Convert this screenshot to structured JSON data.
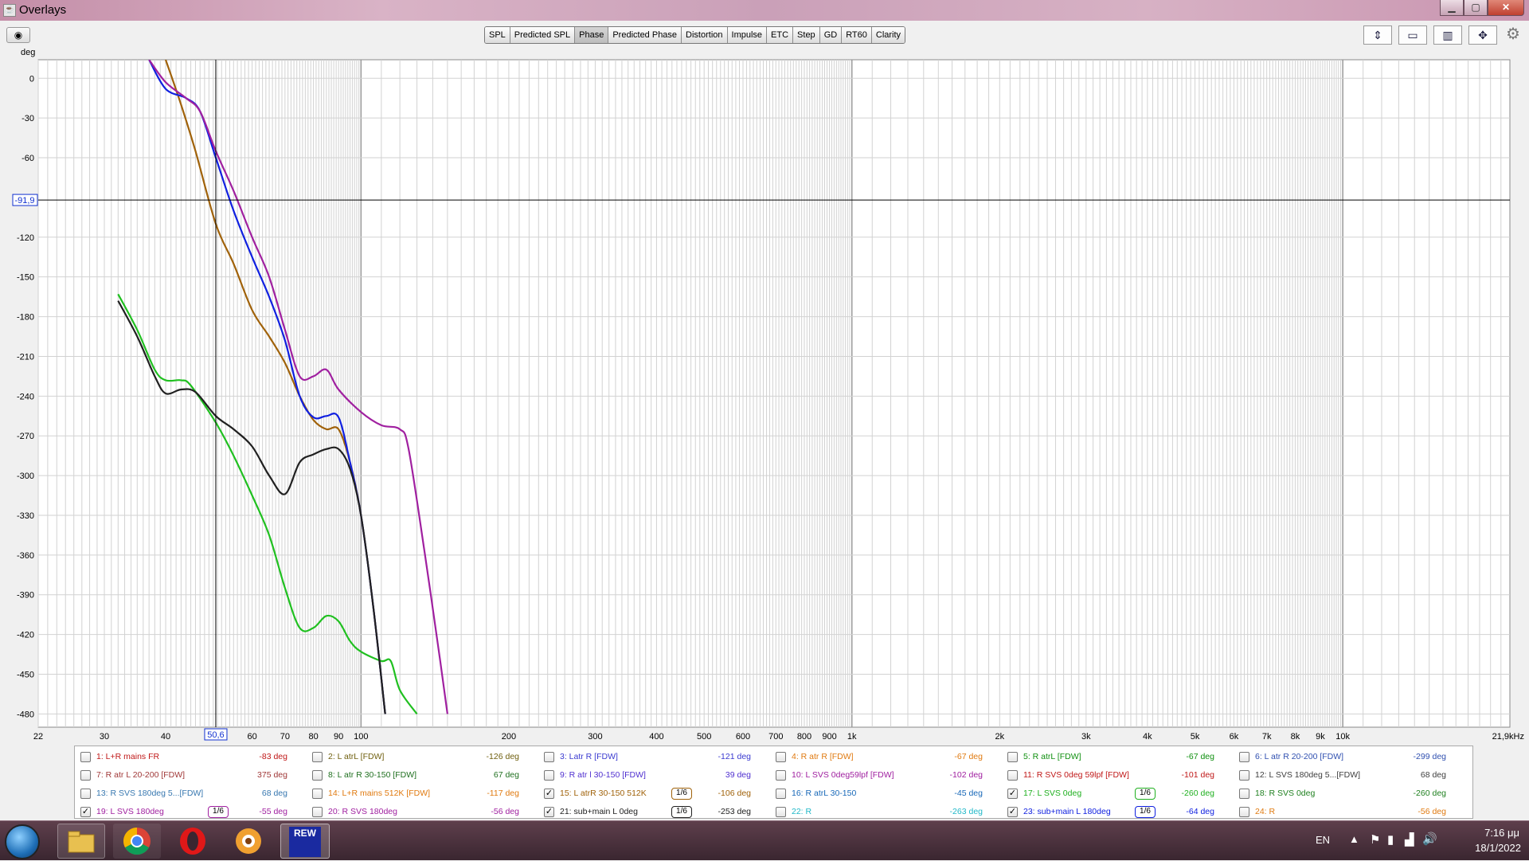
{
  "window": {
    "title": "Overlays",
    "minimize": "▁",
    "maximize": "▢",
    "close": "✕"
  },
  "toolbar": {
    "tabs": [
      "SPL",
      "Predicted SPL",
      "Phase",
      "Predicted Phase",
      "Distortion",
      "Impulse",
      "ETC",
      "Step",
      "GD",
      "RT60",
      "Clarity"
    ],
    "active_tab": "Phase"
  },
  "chart": {
    "y_unit": "deg",
    "y_ticks": [
      "0",
      "-30",
      "-60",
      "-120",
      "-150",
      "-180",
      "-210",
      "-240",
      "-270",
      "-300",
      "-330",
      "-360",
      "-390",
      "-420",
      "-450",
      "-480"
    ],
    "x_ticks": [
      "22",
      "30",
      "40",
      "60",
      "70",
      "80",
      "90",
      "100",
      "200",
      "300",
      "400",
      "500",
      "600",
      "700",
      "800",
      "900",
      "1k",
      "2k",
      "3k",
      "4k",
      "5k",
      "6k",
      "7k",
      "8k",
      "9k",
      "10k",
      "21,9kHz"
    ],
    "cursor_x": "50,6",
    "cursor_y": "-91,9"
  },
  "chart_data": {
    "type": "line",
    "x_scale": "log",
    "x_range_hz": [
      22,
      21900
    ],
    "y_range_deg": [
      -490,
      14
    ],
    "cursor": {
      "x_hz": 50.6,
      "y_deg": -91.9
    },
    "series": [
      {
        "name": "15: L atrR 30-150 512K",
        "color": "#a0620a",
        "points": [
          [
            40,
            14
          ],
          [
            43,
            -20
          ],
          [
            46,
            -55
          ],
          [
            50.6,
            -110
          ],
          [
            55,
            -140
          ],
          [
            60,
            -175
          ],
          [
            65,
            -195
          ],
          [
            70,
            -215
          ],
          [
            75,
            -240
          ],
          [
            80,
            -258
          ],
          [
            85,
            -265
          ],
          [
            90,
            -265
          ],
          [
            95,
            -290
          ],
          [
            100,
            -330
          ],
          [
            106,
            -400
          ],
          [
            112,
            -480
          ]
        ]
      },
      {
        "name": "23: sub+main L 180deg",
        "color": "#1020e0",
        "points": [
          [
            37,
            14
          ],
          [
            40,
            -8
          ],
          [
            44,
            -15
          ],
          [
            47,
            -25
          ],
          [
            50.6,
            -60
          ],
          [
            55,
            -100
          ],
          [
            60,
            -135
          ],
          [
            65,
            -165
          ],
          [
            70,
            -198
          ],
          [
            75,
            -240
          ],
          [
            80,
            -256
          ],
          [
            85,
            -255
          ],
          [
            90,
            -256
          ],
          [
            95,
            -290
          ],
          [
            100,
            -330
          ],
          [
            106,
            -400
          ],
          [
            112,
            -480
          ]
        ]
      },
      {
        "name": "19: L SVS 180deg",
        "color": "#a020a0",
        "points": [
          [
            37,
            14
          ],
          [
            40,
            -3
          ],
          [
            44,
            -15
          ],
          [
            47,
            -25
          ],
          [
            50.6,
            -55
          ],
          [
            55,
            -85
          ],
          [
            60,
            -120
          ],
          [
            65,
            -150
          ],
          [
            70,
            -190
          ],
          [
            75,
            -225
          ],
          [
            80,
            -225
          ],
          [
            85,
            -220
          ],
          [
            90,
            -235
          ],
          [
            100,
            -252
          ],
          [
            110,
            -262
          ],
          [
            120,
            -265
          ],
          [
            125,
            -280
          ],
          [
            135,
            -360
          ],
          [
            145,
            -440
          ],
          [
            150,
            -480
          ]
        ]
      },
      {
        "name": "17: L SVS 0deg",
        "color": "#20c020",
        "points": [
          [
            32,
            -163
          ],
          [
            35,
            -190
          ],
          [
            38,
            -220
          ],
          [
            40,
            -228
          ],
          [
            43,
            -228
          ],
          [
            45,
            -232
          ],
          [
            50.6,
            -260
          ],
          [
            55,
            -285
          ],
          [
            60,
            -315
          ],
          [
            65,
            -345
          ],
          [
            70,
            -385
          ],
          [
            75,
            -415
          ],
          [
            80,
            -415
          ],
          [
            85,
            -406
          ],
          [
            90,
            -410
          ],
          [
            95,
            -425
          ],
          [
            100,
            -433
          ],
          [
            110,
            -440
          ],
          [
            115,
            -440
          ],
          [
            120,
            -462
          ],
          [
            130,
            -480
          ]
        ]
      },
      {
        "name": "21: sub+main L 0deg",
        "color": "#202020",
        "points": [
          [
            32,
            -168
          ],
          [
            35,
            -195
          ],
          [
            38,
            -225
          ],
          [
            40,
            -238
          ],
          [
            43,
            -235
          ],
          [
            46,
            -237
          ],
          [
            50.6,
            -255
          ],
          [
            55,
            -265
          ],
          [
            60,
            -278
          ],
          [
            65,
            -300
          ],
          [
            70,
            -314
          ],
          [
            75,
            -290
          ],
          [
            80,
            -284
          ],
          [
            85,
            -280
          ],
          [
            90,
            -280
          ],
          [
            95,
            -295
          ],
          [
            100,
            -330
          ],
          [
            106,
            -400
          ],
          [
            112,
            -480
          ]
        ]
      }
    ]
  },
  "legend": [
    [
      {
        "n": "1: L+R mains FR",
        "v": "-83 deg",
        "c": "#c01818",
        "k": false
      },
      {
        "n": "2: L atrL [FDW]",
        "v": "-126 deg",
        "c": "#706010",
        "k": false
      },
      {
        "n": "3: Latr R [FDW]",
        "v": "-121 deg",
        "c": "#3a3ad0",
        "k": false
      },
      {
        "n": "4: R atr R [FDW]",
        "v": "-67 deg",
        "c": "#e07a10",
        "k": false
      },
      {
        "n": "5: R atrL [FDW]",
        "v": "-67 deg",
        "c": "#109010",
        "k": false
      },
      {
        "n": "6: L atr R 20-200 [FDW]",
        "v": "-299 deg",
        "c": "#3050b0",
        "k": false
      }
    ],
    [
      {
        "n": "7: R atr L 20-200 [FDW]",
        "v": "375 deg",
        "c": "#a03838",
        "k": false
      },
      {
        "n": "8: L atr R 30-150 [FDW]",
        "v": "67 deg",
        "c": "#207020",
        "k": false
      },
      {
        "n": "9: R atr l 30-150 [FDW]",
        "v": "39 deg",
        "c": "#5030d0",
        "k": false
      },
      {
        "n": "10: L SVS 0deg59lpf [FDW]",
        "v": "-102 deg",
        "c": "#a020a0",
        "k": false
      },
      {
        "n": "11: R SVS 0deg 59lpf [FDW]",
        "v": "-101 deg",
        "c": "#c01818",
        "k": false
      },
      {
        "n": "12: L SVS 180deg 5...[FDW]",
        "v": "68 deg",
        "c": "#404040",
        "k": false
      }
    ],
    [
      {
        "n": "13: R SVS 180deg 5...[FDW]",
        "v": "68 deg",
        "c": "#3878b0",
        "k": false
      },
      {
        "n": "14: L+R mains 512K [FDW]",
        "v": "-117 deg",
        "c": "#e07a10",
        "k": false
      },
      {
        "n": "15: L atrR 30-150 512K",
        "v": "-106 deg",
        "c": "#a0620a",
        "k": true,
        "s": "1/6"
      },
      {
        "n": "16: R atrL 30-150",
        "v": "-45 deg",
        "c": "#1868b8",
        "k": false
      },
      {
        "n": "17: L SVS 0deg",
        "v": "-260 deg",
        "c": "#20b020",
        "k": true,
        "s": "1/6"
      },
      {
        "n": "18: R SVS 0deg",
        "v": "-260 deg",
        "c": "#208020",
        "k": false
      }
    ],
    [
      {
        "n": "19: L SVS 180deg",
        "v": "-55 deg",
        "c": "#a020a0",
        "k": true,
        "s": "1/6"
      },
      {
        "n": "20: R SVS 180deg",
        "v": "-56 deg",
        "c": "#a020a0",
        "k": false
      },
      {
        "n": "21: sub+main  L 0deg",
        "v": "-253 deg",
        "c": "#202020",
        "k": true,
        "s": "1/6"
      },
      {
        "n": "22: R",
        "v": "-263 deg",
        "c": "#20b8c8",
        "k": false
      },
      {
        "n": "23: sub+main L 180deg",
        "v": "-64 deg",
        "c": "#1020e0",
        "k": true,
        "s": "1/6"
      },
      {
        "n": "24: R",
        "v": "-56 deg",
        "c": "#e07a10",
        "k": false
      }
    ]
  ],
  "taskbar": {
    "rew_label": "REW",
    "lang": "EN",
    "time": "7:16 μμ",
    "date": "18/1/2022"
  }
}
